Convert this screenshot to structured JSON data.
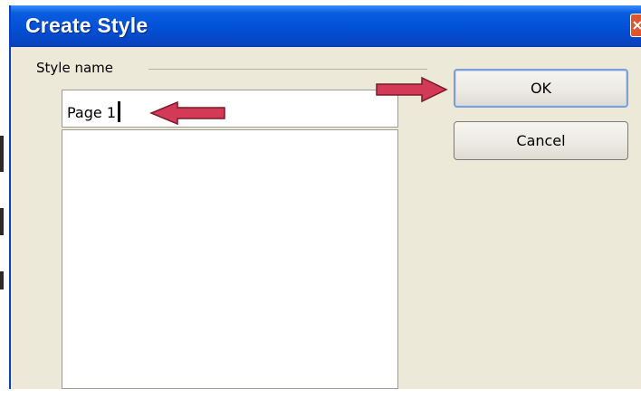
{
  "dialog": {
    "title": "Create Style"
  },
  "style_group": {
    "label": "Style name",
    "name_value": "Page 1"
  },
  "buttons": {
    "ok_label": "OK",
    "cancel_label": "Cancel"
  },
  "annotations": {
    "arrow_color": "#d23a55"
  },
  "colors": {
    "titlebar": "#0250d6",
    "dialog_bg": "#ece9d8",
    "close_button": "#e0562c"
  }
}
